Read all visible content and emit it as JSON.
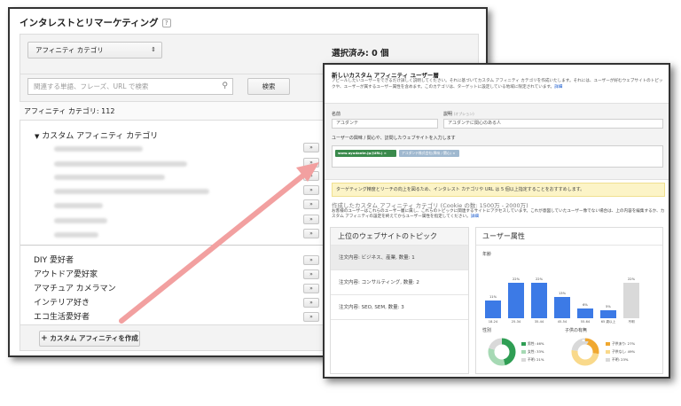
{
  "back": {
    "title": "インタレストとリマーケティング",
    "help": "?",
    "dropdown_value": "アフィニティ カテゴリ",
    "selected_label": "選択済み: 0 個",
    "search_placeholder": "関連する単語、フレーズ、URL で検索",
    "search_button": "検索",
    "category_count": "アフィニティ カテゴリ: 112",
    "custom_group": "カスタム アフィニティ カテゴリ",
    "add_symbol": "»",
    "items": [
      "DIY 愛好者",
      "アウトドア愛好家",
      "アマチュア カメラマン",
      "インテリア好き",
      "エコ生活愛好者"
    ],
    "create_button": "カスタム アフィニティを作成",
    "plus": "+"
  },
  "front": {
    "title": "新しいカスタム アフィニティ ユーザー層",
    "description": "アピールしたいユーザーをできるだけ詳しく説明してください。それに基づいてカスタム アフィニティ カテゴリを作成いたします。それには、ユーザーが好むウェブサイトのトピックや、ユーザーが属するユーザー属性を含めます。このカテゴリは、ターゲットに設定している地域に限定されています。",
    "description_link": "詳細",
    "name_label": "名前",
    "name_value": "アユダンテ",
    "desc_label": "説明",
    "desc_optional": "(オプション)",
    "desc_value": "アユダンテに関心のある人",
    "url_prompt": "ユーザーの興味 / 関心や、訪問したウェブサイトを入力します",
    "tags": [
      "www.ayudante.jp/(URL) ×",
      "アユダンテ株式会社(興味 / 関心) ×"
    ],
    "notice": "ターゲティング精度とリーチの向上を図るため、インタレスト カテゴリや URL は 5 個以上指定することをおすすめします。",
    "created_title": "作成したカスタム アフィニティ カテゴリ (Cookie の数: 1500万 - 2000万)",
    "created_desc": "お客様のユーザーはこれらのユーザー層に属し、これらのトピックに関連するサイトにアクセスしています。これが意図していたユーザー像でない場合は、上の内容を編集するか、カスタム アフィニティの設定を終えてからユーザー属性を指定してください。",
    "created_link": "詳細",
    "topics_title": "上位のウェブサイトのトピック",
    "topics": [
      "注文内容: ビジネス、産業, 数量: 1",
      "注文内容: コンサルティング, 数量: 2",
      "注文内容: SEO, SEM, 数量: 3"
    ],
    "demo_title": "ユーザー属性",
    "age_label": "年齢",
    "gender_label": "性別",
    "parent_label": "子供の有無",
    "gender_legend": [
      "男性: 46%",
      "女性: 33%",
      "不明: 21%"
    ],
    "parent_legend": [
      "子供あり: 27%",
      "子供なし: 49%",
      "不明: 23%"
    ],
    "colors": {
      "blue": "#3c7ae6",
      "green": "#2f9e54",
      "lightgreen": "#a6d9b4",
      "orange": "#f0a830",
      "lightorange": "#f9d98b",
      "gray": "#d9d9d9"
    }
  },
  "chart_data": {
    "type": "bar",
    "categories": [
      "18-24",
      "25-34",
      "35-44",
      "45-54",
      "55-64",
      "65 歳以上",
      "不明"
    ],
    "values": [
      11,
      22,
      22,
      13,
      6,
      5,
      22
    ],
    "value_labels": [
      "11%",
      "22%",
      "22%",
      "13%",
      "6%",
      "5%",
      "22%"
    ],
    "title": "年齢",
    "colors": [
      "#3c7ae6",
      "#3c7ae6",
      "#3c7ae6",
      "#3c7ae6",
      "#3c7ae6",
      "#3c7ae6",
      "#d9d9d9"
    ],
    "ylim": [
      0,
      25
    ],
    "gender": {
      "values": [
        46,
        33,
        21
      ],
      "labels": [
        "男性",
        "女性",
        "不明"
      ]
    },
    "parental": {
      "values": [
        27,
        49,
        23
      ],
      "labels": [
        "子供あり",
        "子供なし",
        "不明"
      ]
    }
  }
}
